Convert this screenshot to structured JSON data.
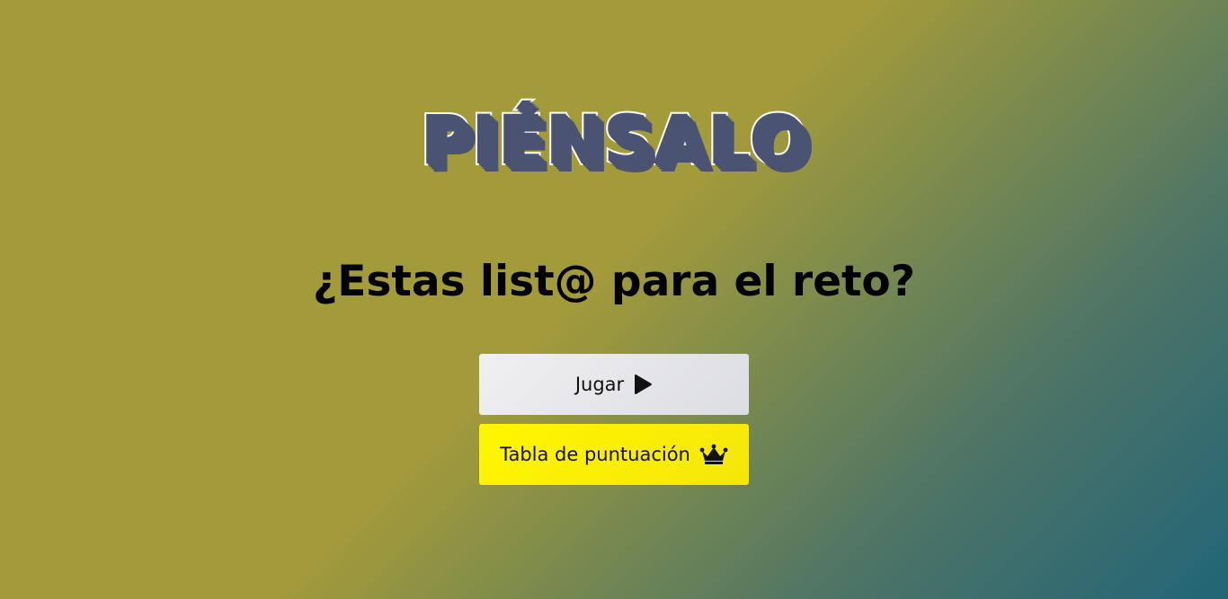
{
  "logo": {
    "text": "PIÉNSALO"
  },
  "headline": {
    "text": "¿Estas list@ para el reto?"
  },
  "buttons": {
    "play": {
      "label": "Jugar",
      "icon": "play-icon"
    },
    "scoreboard": {
      "label": "Tabla de puntuación",
      "icon": "crown-icon"
    }
  },
  "colors": {
    "background_start": "#a39a3a",
    "background_end": "#216577",
    "logo_fill": "#4a5372",
    "logo_stroke": "#ffffff",
    "play_button": "#e4e5e9",
    "scoreboard_button": "#fff700"
  }
}
